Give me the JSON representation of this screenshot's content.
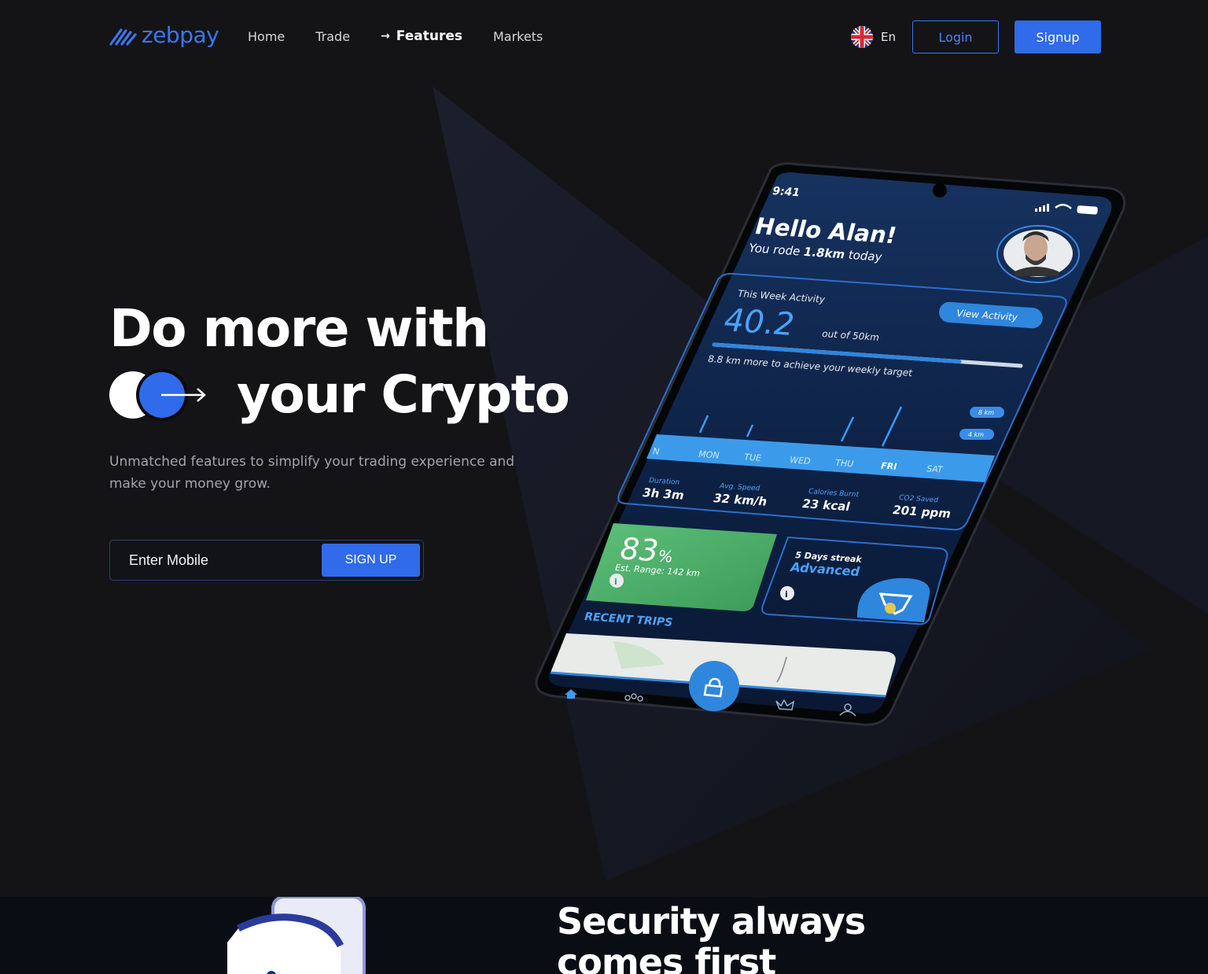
{
  "brand": {
    "name": "zebpay",
    "color": "#3b76f0"
  },
  "nav": {
    "links": [
      {
        "label": "Home"
      },
      {
        "label": "Trade"
      },
      {
        "label": "Features",
        "active": true
      },
      {
        "label": "Markets"
      }
    ],
    "language": "En",
    "login_label": "Login",
    "signup_label": "Signup"
  },
  "hero": {
    "title_line1": "Do more with",
    "title_line2": "your Crypto",
    "subtitle": "Unmatched features to simplify your trading experience and make your money grow.",
    "mobile_placeholder": "Enter Mobile",
    "signup_button": "SIGN UP"
  },
  "phone": {
    "time": "9:41",
    "greeting": "Hello Alan!",
    "rode_prefix": "You rode ",
    "rode_value": "1.8km",
    "rode_suffix": " today",
    "activity_title": "This Week Activity",
    "activity_value": "40.2",
    "activity_out_of": "out of 50km",
    "view_activity": "View Activity",
    "target_text": "8.8 km more to achieve your weekly target",
    "progress": 0.8,
    "days": [
      "N",
      "MON",
      "TUE",
      "WED",
      "THU",
      "FRI",
      "SAT"
    ],
    "active_day": "FRI",
    "chips": [
      "8 km",
      "4 km"
    ],
    "stats": [
      {
        "label": "Duration",
        "value": "3h 3m"
      },
      {
        "label": "Avg. Speed",
        "value": "32 km/h"
      },
      {
        "label": "Calories Burnt",
        "value": "23 kcal"
      },
      {
        "label": "CO2 Saved",
        "value": "201 ppm"
      }
    ],
    "battery_percent": "83",
    "battery_unit": "%",
    "range_text": "Est. Range: 142 km",
    "streak_text": "5 Days streak",
    "streak_level": "Advanced",
    "recent_trips": "RECENT TRIPS"
  },
  "security": {
    "title_line1": "Security always",
    "title_line2": "comes first"
  },
  "colors": {
    "accent": "#2f6bea",
    "background": "#141416",
    "phone_screen": "#0f2447",
    "green_card": "#4fb06b"
  }
}
